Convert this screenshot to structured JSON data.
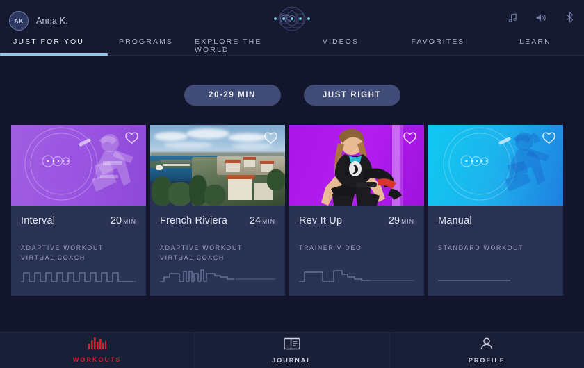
{
  "header": {
    "user_initials": "AK",
    "user_name": "Anna K.",
    "logo_name": "orbit-logo",
    "system_icons": [
      {
        "name": "music-icon",
        "glyph": "♫"
      },
      {
        "name": "volume-icon",
        "glyph": "🔊"
      },
      {
        "name": "bluetooth-icon",
        "glyph": "ᛦ"
      }
    ]
  },
  "nav": {
    "active_index": 0,
    "tabs": [
      {
        "label": "JUST FOR YOU"
      },
      {
        "label": "PROGRAMS"
      },
      {
        "label": "EXPLORE THE WORLD"
      },
      {
        "label": "VIDEOS"
      },
      {
        "label": "FAVORITES"
      },
      {
        "label": "LEARN"
      }
    ]
  },
  "filters": [
    {
      "label": "20-29 MIN"
    },
    {
      "label": "JUST RIGHT"
    }
  ],
  "cards": [
    {
      "title": "Interval",
      "duration": "20",
      "duration_unit": "MIN",
      "tags": [
        "ADAPTIVE WORKOUT",
        "VIRTUAL COACH"
      ],
      "thumb_style": "purple-hud",
      "favorite": false,
      "profile_type": "intervals"
    },
    {
      "title": "French Riviera",
      "duration": "24",
      "duration_unit": "MIN",
      "tags": [
        "ADAPTIVE WORKOUT",
        "VIRTUAL COACH"
      ],
      "thumb_style": "riviera-photo",
      "favorite": false,
      "profile_type": "terrain"
    },
    {
      "title": "Rev It Up",
      "duration": "29",
      "duration_unit": "MIN",
      "tags": [
        "TRAINER VIDEO"
      ],
      "thumb_style": "magenta-trainer",
      "favorite": false,
      "profile_type": "plateaus"
    },
    {
      "title": "Manual",
      "duration": "",
      "duration_unit": "",
      "tags": [
        "STANDARD WORKOUT"
      ],
      "thumb_style": "cyan-hud",
      "favorite": false,
      "profile_type": "flat"
    }
  ],
  "bottom_nav": {
    "active_index": 0,
    "active_color": "#e01b34",
    "items": [
      {
        "label": "WORKOUTS",
        "icon": "bars-icon"
      },
      {
        "label": "JOURNAL",
        "icon": "book-icon"
      },
      {
        "label": "PROFILE",
        "icon": "person-icon"
      }
    ]
  },
  "colors": {
    "app_bg": "#12152b",
    "bar_bg": "#161a30",
    "card_bg": "#2b3355",
    "pill_bg": "#424c78",
    "accent_underline": "#8ec8ea"
  }
}
